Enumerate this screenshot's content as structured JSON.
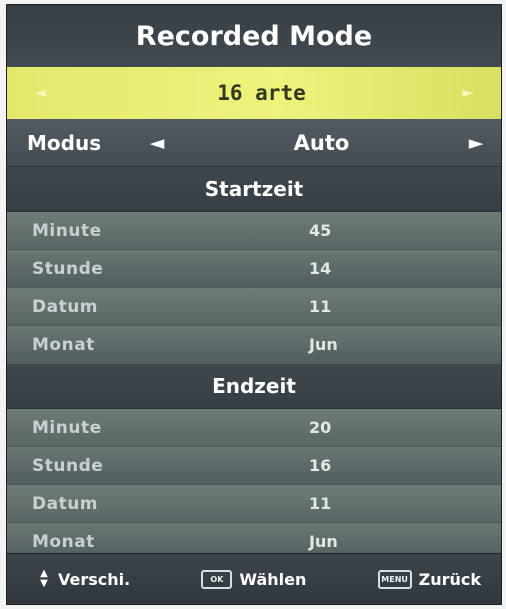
{
  "menu": {
    "title": "Recorded Mode",
    "channel": {
      "left_arrow": "◄",
      "name": "16 arte",
      "right_arrow": "►"
    },
    "modus": {
      "label": "Modus",
      "value": "Auto",
      "left_arrow": "◄",
      "right_arrow": "►"
    },
    "start": {
      "title": "Startzeit",
      "rows": [
        {
          "label": "Minute",
          "value": "45"
        },
        {
          "label": "Stunde",
          "value": "14"
        },
        {
          "label": "Datum",
          "value": "11"
        },
        {
          "label": "Monat",
          "value": "Jun"
        }
      ]
    },
    "end": {
      "title": "Endzeit",
      "rows": [
        {
          "label": "Minute",
          "value": "20"
        },
        {
          "label": "Stunde",
          "value": "16"
        },
        {
          "label": "Datum",
          "value": "11"
        },
        {
          "label": "Monat",
          "value": "Jun"
        }
      ]
    },
    "footer": {
      "move_icon": "up-down-arrows-icon",
      "move_label": "Verschi.",
      "ok_icon": "ok-key-icon",
      "ok_key_text": "OK",
      "ok_label": "Wählen",
      "back_icon": "menu-key-icon",
      "back_key_text": "MENU",
      "back_label": "Zurück"
    }
  },
  "colors": {
    "background": "#3d464d",
    "highlight": "#e6eb73",
    "row": "#687473",
    "text": "#ffffff"
  }
}
